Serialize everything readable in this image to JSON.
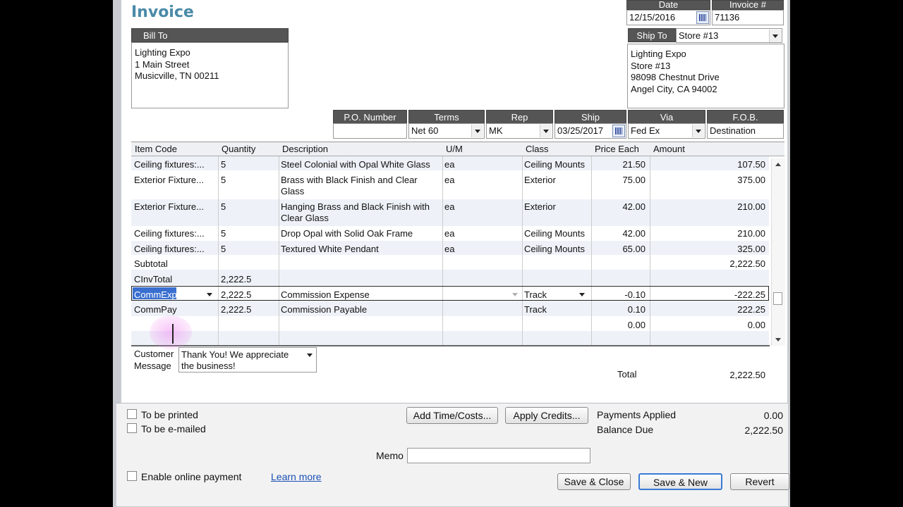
{
  "header": {
    "title": "Invoice",
    "date_label": "Date",
    "date_value": "12/15/2016",
    "invoice_no_label": "Invoice #",
    "invoice_no_value": "71136",
    "bill_to_label": "Bill To",
    "bill_to": "Lighting Expo\n1 Main Street\nMusicville, TN 00211",
    "ship_to_label": "Ship To",
    "ship_to_select": "Store #13",
    "ship_to": "Lighting Expo\nStore #13\n98098 Chestnut Drive\nAngel City, CA 94002"
  },
  "order": {
    "po_label": "P.O. Number",
    "po_value": "",
    "terms_label": "Terms",
    "terms_value": "Net 60",
    "rep_label": "Rep",
    "rep_value": "MK",
    "ship_label": "Ship",
    "ship_value": "03/25/2017",
    "via_label": "Via",
    "via_value": "Fed Ex",
    "fob_label": "F.O.B.",
    "fob_value": "Destination"
  },
  "table": {
    "columns": [
      "Item Code",
      "Quantity",
      "Description",
      "U/M",
      "Class",
      "Price Each",
      "Amount"
    ],
    "rows": [
      {
        "item": "Ceiling fixtures:...",
        "qty": "5",
        "desc": "Steel Colonial with Opal White Glass",
        "um": "ea",
        "class": "Ceiling Mounts",
        "price": "21.50",
        "amount": "107.50"
      },
      {
        "item": "Exterior Fixture...",
        "qty": "5",
        "desc": "Brass with Black Finish and Clear Glass",
        "um": "ea",
        "class": "Exterior",
        "price": "75.00",
        "amount": "375.00"
      },
      {
        "item": "Exterior Fixture...",
        "qty": "5",
        "desc": "Hanging Brass and Black Finish with Clear Glass",
        "um": "ea",
        "class": "Exterior",
        "price": "42.00",
        "amount": "210.00"
      },
      {
        "item": "Ceiling fixtures:...",
        "qty": "5",
        "desc": "Drop Opal with Solid Oak Frame",
        "um": "ea",
        "class": "Ceiling Mounts",
        "price": "42.00",
        "amount": "210.00"
      },
      {
        "item": "Ceiling fixtures:...",
        "qty": "5",
        "desc": "Textured White Pendant",
        "um": "ea",
        "class": "Ceiling Mounts",
        "price": "65.00",
        "amount": "325.00"
      },
      {
        "item": "Subtotal",
        "qty": "",
        "desc": "",
        "um": "",
        "class": "",
        "price": "",
        "amount": "2,222.50"
      },
      {
        "item": "CInvTotal",
        "qty": "2,222.5",
        "desc": "",
        "um": "",
        "class": "",
        "price": "",
        "amount": ""
      },
      {
        "item": "CommExp",
        "qty": "2,222.5",
        "desc": "Commission Expense",
        "um": "",
        "class": "Track",
        "price": "-0.10",
        "amount": "-222.25"
      },
      {
        "item": "CommPay",
        "qty": "2,222.5",
        "desc": "Commission Payable",
        "um": "",
        "class": "Track",
        "price": "0.10",
        "amount": "222.25"
      },
      {
        "item": "",
        "qty": "",
        "desc": "",
        "um": "",
        "class": "",
        "price": "0.00",
        "amount": "0.00"
      }
    ]
  },
  "footer": {
    "customer_message_label": "Customer Message",
    "customer_message_value": "Thank You!  We appreciate the business!",
    "total_label": "Total",
    "total_value": "2,222.50",
    "to_be_printed": "To be printed",
    "to_be_emailed": "To be e-mailed",
    "add_time_costs": "Add Time/Costs...",
    "apply_credits": "Apply Credits...",
    "payments_applied_label": "Payments Applied",
    "payments_applied_value": "0.00",
    "balance_due_label": "Balance Due",
    "balance_due_value": "2,222.50",
    "memo_label": "Memo",
    "memo_value": "",
    "enable_online_payment": "Enable online payment",
    "learn_more": "Learn more",
    "save_close": "Save & Close",
    "save_new": "Save & New",
    "revert": "Revert"
  }
}
